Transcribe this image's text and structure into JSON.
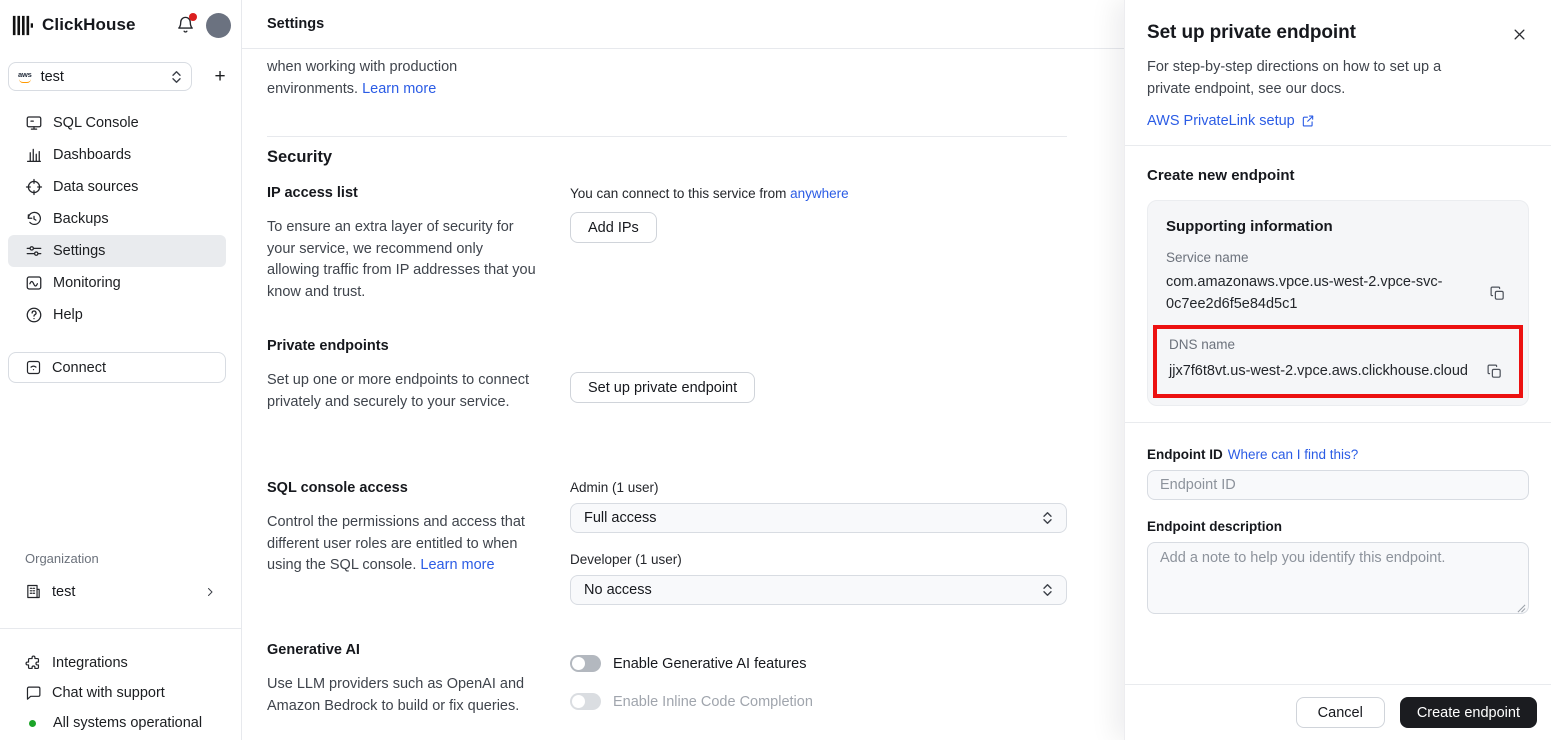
{
  "colors": {
    "link_blue": "#2b5ce5",
    "annotation_red": "#ec1111",
    "status_green": "#1ca428",
    "notification_red": "#db1f1f",
    "dark_button": "#1b1c20"
  },
  "sidebar": {
    "brand": "ClickHouse",
    "service_selector": {
      "value": "test",
      "provider_icon": "aws-icon"
    },
    "add_button": "+",
    "nav": [
      {
        "label": "SQL Console",
        "icon": "sql-console-icon"
      },
      {
        "label": "Dashboards",
        "icon": "dashboards-icon"
      },
      {
        "label": "Data sources",
        "icon": "data-sources-icon"
      },
      {
        "label": "Backups",
        "icon": "backups-icon"
      },
      {
        "label": "Settings",
        "icon": "settings-sliders-icon",
        "active": true
      },
      {
        "label": "Monitoring",
        "icon": "monitoring-icon"
      },
      {
        "label": "Help",
        "icon": "help-icon"
      }
    ],
    "connect_label": "Connect",
    "organization": {
      "label": "Organization",
      "name": "test"
    },
    "footer": {
      "integrations": "Integrations",
      "chat": "Chat with support",
      "status": "All systems operational"
    }
  },
  "header": {
    "title": "Settings"
  },
  "main": {
    "intro_text": "when working with production environments. ",
    "intro_link": "Learn more",
    "security_heading": "Security",
    "ip_access": {
      "title": "IP access list",
      "description": "To ensure an extra layer of security for your service, we recommend only allowing traffic from IP addresses that you know and trust.",
      "connect_text": "You can connect to this service from ",
      "connect_link": "anywhere",
      "button": "Add IPs"
    },
    "private_endpoints": {
      "title": "Private endpoints",
      "description": "Set up one or more endpoints to connect privately and securely to your service.",
      "button": "Set up private endpoint"
    },
    "sql_access": {
      "title": "SQL console access",
      "description": "Control the permissions and access that different user roles are entitled to when using the SQL console. ",
      "link": "Learn more",
      "admin_label": "Admin (1 user)",
      "admin_value": "Full access",
      "developer_label": "Developer (1 user)",
      "developer_value": "No access"
    },
    "generative_ai": {
      "title": "Generative AI",
      "description": "Use LLM providers such as OpenAI and Amazon Bedrock to build or fix queries.",
      "toggle_features": "Enable Generative AI features",
      "toggle_inline": "Enable Inline Code Completion"
    }
  },
  "panel": {
    "title": "Set up private endpoint",
    "description": "For step-by-step directions on how to set up a private endpoint, see our docs.",
    "docs_link": "AWS PrivateLink setup",
    "section_title": "Create new endpoint",
    "supporting": {
      "title": "Supporting information",
      "service_name_label": "Service name",
      "service_name_value": "com.amazonaws.vpce.us-west-2.vpce-svc-0c7ee2d6f5e84d5c1",
      "dns_label": "DNS name",
      "dns_value": "jjx7f6t8vt.us-west-2.vpce.aws.clickhouse.cloud"
    },
    "endpoint_id_label": "Endpoint ID ",
    "endpoint_id_link": "Where can I find this?",
    "endpoint_id_placeholder": "Endpoint ID",
    "endpoint_desc_label": "Endpoint description",
    "endpoint_desc_placeholder": "Add a note to help you identify this endpoint.",
    "cancel_button": "Cancel",
    "create_button": "Create endpoint"
  }
}
